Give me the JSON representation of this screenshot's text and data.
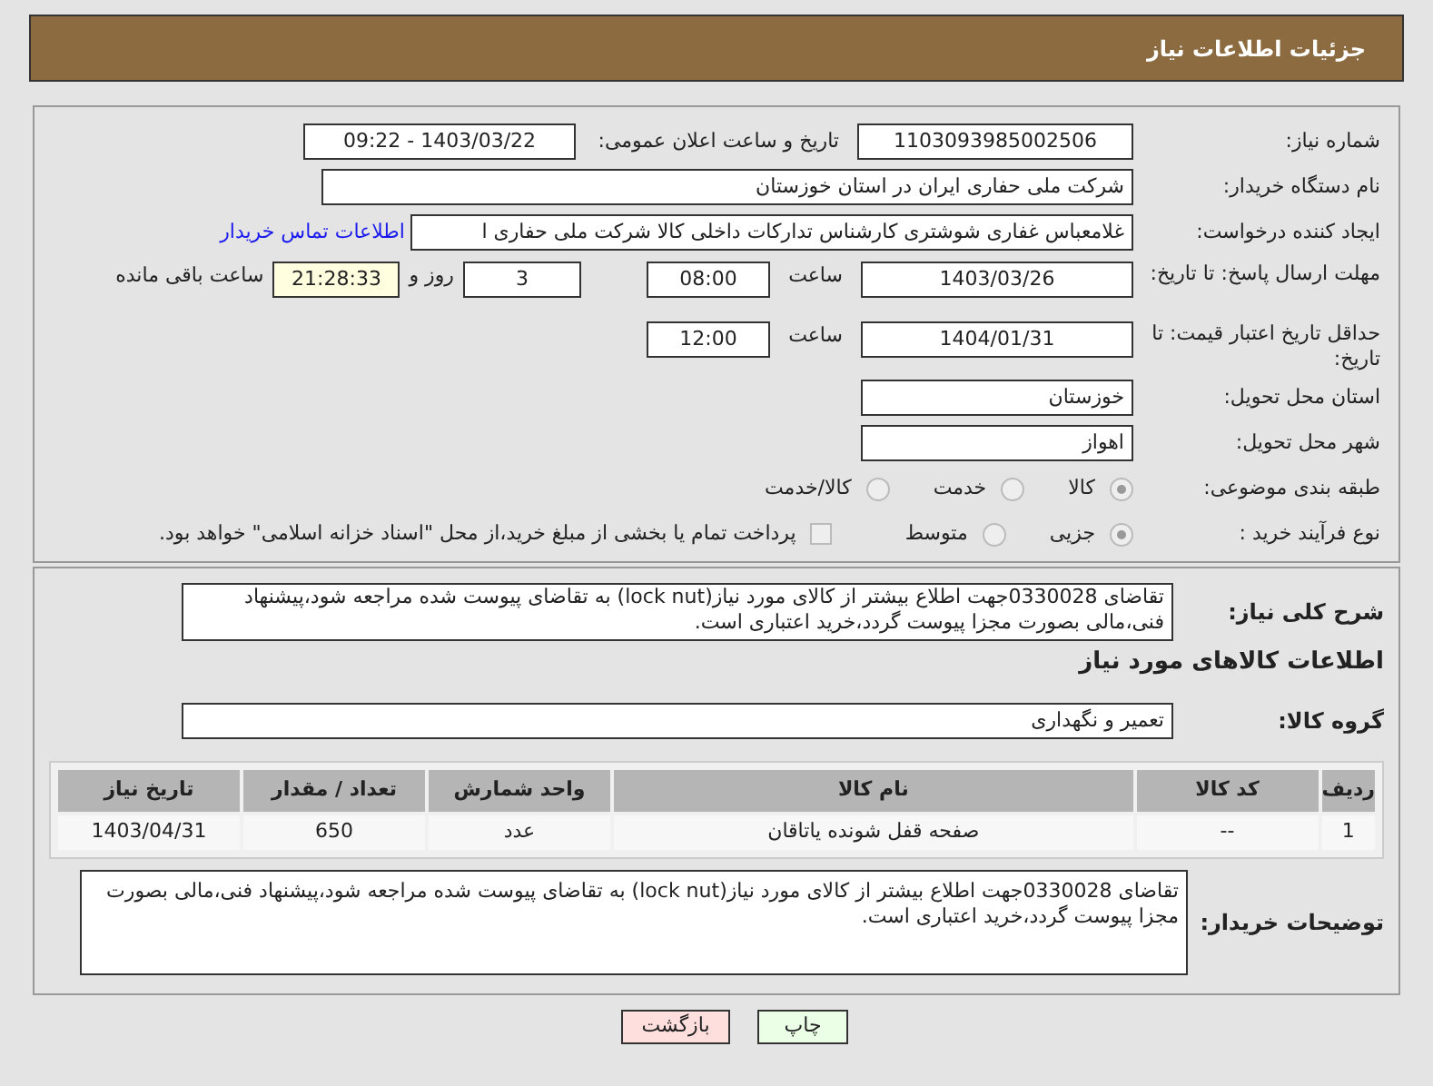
{
  "header": {
    "title": "جزئیات اطلاعات نیاز"
  },
  "need_number": {
    "label": "شماره نیاز:",
    "value": "1103093985002506"
  },
  "announce": {
    "label": "تاریخ و ساعت اعلان عمومی:",
    "value": "1403/03/22 - 09:22"
  },
  "buyer_org": {
    "label": "نام دستگاه خریدار:",
    "value": "شرکت ملی حفاری ایران در استان خوزستان"
  },
  "requester": {
    "label": "ایجاد کننده درخواست:",
    "value": "غلامعباس غفاری شوشتری کارشناس تدارکات داخلی کالا شرکت ملی حفاری ا",
    "link": "اطلاعات تماس خریدار"
  },
  "reply_deadline": {
    "label": "مهلت ارسال پاسخ: تا تاریخ:",
    "date": "1403/03/26",
    "time_label": "ساعت",
    "time": "08:00",
    "days": "3",
    "days_label": "روز و",
    "remaining": "21:28:33",
    "remaining_label": "ساعت باقی مانده"
  },
  "price_validity": {
    "label": "حداقل تاریخ اعتبار قیمت: تا تاریخ:",
    "date": "1404/01/31",
    "time_label": "ساعت",
    "time": "12:00"
  },
  "province": {
    "label": "استان محل تحویل:",
    "value": "خوزستان"
  },
  "city": {
    "label": "شهر محل تحویل:",
    "value": "اهواز"
  },
  "category": {
    "label": "طبقه بندی موضوعی:",
    "options": [
      {
        "label": "كالا",
        "selected": true
      },
      {
        "label": "خدمت",
        "selected": false
      },
      {
        "label": "كالا/خدمت",
        "selected": false
      }
    ]
  },
  "process": {
    "label": "نوع فرآیند خرید :",
    "options": [
      {
        "label": "جزیی",
        "selected": true
      },
      {
        "label": "متوسط",
        "selected": false
      }
    ],
    "payment": {
      "label": "پرداخت تمام یا بخشی از مبلغ خرید،از محل \"اسناد خزانه اسلامی\" خواهد بود.",
      "checked": false
    }
  },
  "description": {
    "label": "شرح کلی نیاز:",
    "value": "تقاضای 0330028جهت اطلاع بیشتر از کالای مورد نیاز(lock nut) به تقاضای پیوست شده مراجعه شود،پیشنهاد فنی،مالی بصورت مجزا پیوست گردد،خرید اعتباری است."
  },
  "goods_heading": "اطلاعات کالاهای مورد نیاز",
  "goods_group": {
    "label": "گروه کالا:",
    "value": "تعمیر و نگهداری"
  },
  "table": {
    "columns": [
      "ردیف",
      "کد کالا",
      "نام کالا",
      "واحد شمارش",
      "تعداد / مقدار",
      "تاریخ نیاز"
    ],
    "rows": [
      [
        "1",
        "--",
        "صفحه قفل شونده یاتاقان",
        "عدد",
        "650",
        "1403/04/31"
      ]
    ]
  },
  "buyer_notes": {
    "label": "توضیحات خریدار:",
    "value": "تقاضای 0330028جهت اطلاع بیشتر از کالای مورد نیاز(lock nut) به تقاضای پیوست شده مراجعه شود،پیشنهاد فنی،مالی بصورت مجزا پیوست گردد،خرید اعتباری است."
  },
  "buttons": [
    {
      "label": "چاپ",
      "kind": "print"
    },
    {
      "label": "بازگشت",
      "kind": "back"
    }
  ]
}
